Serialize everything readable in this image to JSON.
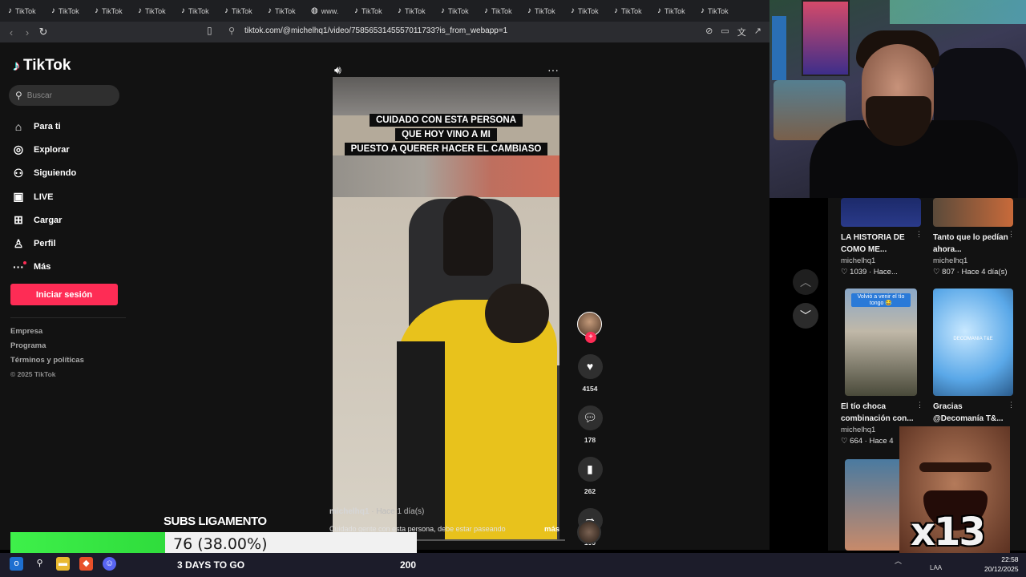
{
  "browser": {
    "tabs": [
      "TikTok",
      "TikTok",
      "TikTok",
      "TikTok",
      "TikTok",
      "TikTok",
      "TikTok",
      "www.",
      "TikTok",
      "TikTok",
      "TikTok",
      "TikTok",
      "TikTok",
      "TikTok",
      "TikTok",
      "TikTok",
      "TikTok"
    ],
    "url": "tiktok.com/@michelhq1/video/7585653145557011733?is_from_webapp=1"
  },
  "sidebar": {
    "logo": "TikTok",
    "search_placeholder": "Buscar",
    "menu": [
      {
        "label": "Para ti",
        "icon": "home-icon"
      },
      {
        "label": "Explorar",
        "icon": "compass-icon"
      },
      {
        "label": "Siguiendo",
        "icon": "following-icon"
      },
      {
        "label": "LIVE",
        "icon": "live-icon"
      },
      {
        "label": "Cargar",
        "icon": "upload-icon"
      },
      {
        "label": "Perfil",
        "icon": "profile-icon"
      },
      {
        "label": "Más",
        "icon": "more-icon"
      }
    ],
    "login_label": "Iniciar sesión",
    "footer": [
      "Empresa",
      "Programa",
      "Términos y políticas"
    ],
    "copyright": "© 2025 TikTok"
  },
  "video": {
    "caption_lines": [
      "CUIDADO CON ESTA PERSONA",
      "QUE HOY VINO A MI",
      "PUESTO A QUERER HACER EL CAMBIASO"
    ],
    "author": "michelhq1",
    "time": "· Hace 1 día(s)",
    "description": "Cuidado gente con esta persona, debe estar paseando",
    "more": "más",
    "likes": "4154",
    "comments": "178",
    "saves": "262",
    "shares": "109"
  },
  "grid": [
    {
      "title": "LA HISTORIA DE COMO ME...",
      "user": "michelhq1",
      "likes": "1039",
      "time": "Hace..."
    },
    {
      "title": "Tanto que lo pedían ahora...",
      "user": "michelhq1",
      "likes": "807",
      "time": "Hace 4 día(s)"
    },
    {
      "title": "El tío choca combinación con...",
      "user": "michelhq1",
      "likes": "664",
      "time": "Hace 4",
      "thumb_text": "Volvió a venir el tío tongo 😂"
    },
    {
      "title": "Gracias @Decomanía T&...",
      "user": "",
      "likes": "",
      "time": "",
      "thumb_text": "DECOMANIA T&E"
    }
  ],
  "overlay": {
    "meme_text": "x13",
    "subs_title": "SUBS LIGAMENTO",
    "subs_value": "76 (38.00%)",
    "subs_fraction": 0.38,
    "days_to_go": "3 DAYS TO GO",
    "goal": "200"
  },
  "taskbar": {
    "lang": "LAA",
    "time": "22:58",
    "date": "20/12/2025"
  }
}
